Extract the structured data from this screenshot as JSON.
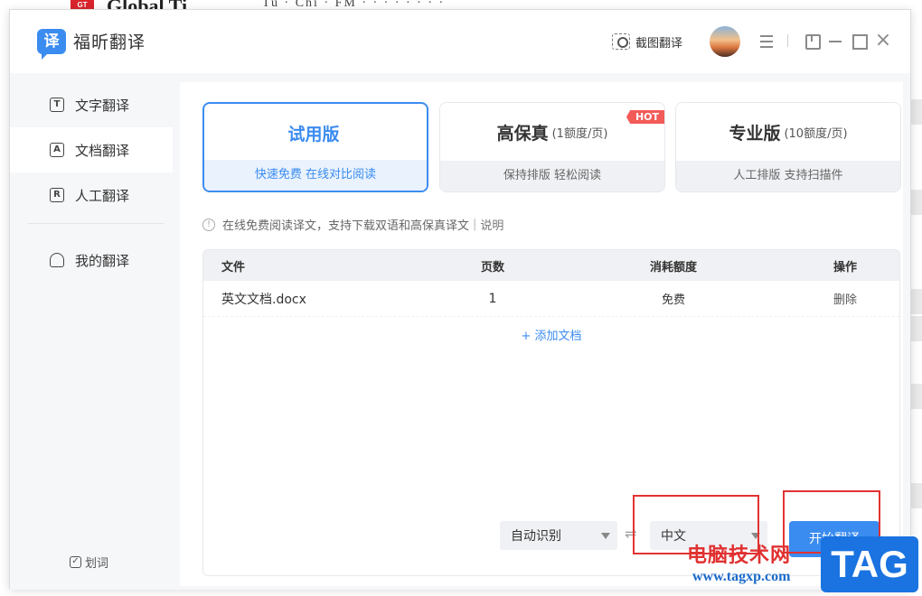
{
  "background": {
    "site_badge": "GT",
    "headline": "Global Ti",
    "subline": "Tu   ·  Chi   ·   FM   ·   ·   ·   ·   ·   ·   ·   ·"
  },
  "titlebar": {
    "logo_char": "译",
    "app_name": "福昕翻译",
    "screenshot_label": "截图翻译",
    "close_glyph": "×"
  },
  "sidebar": {
    "items": [
      {
        "icon": "T",
        "label": "文字翻译"
      },
      {
        "icon": "A",
        "label": "文档翻译"
      },
      {
        "icon": "R",
        "label": "人工翻译"
      },
      {
        "icon": "",
        "label": "我的翻译"
      }
    ],
    "huaci_label": "划词",
    "huaci_check": "✓"
  },
  "plans": [
    {
      "name": "试用版",
      "note": "",
      "desc": "快速免费 在线对比阅读"
    },
    {
      "name": "高保真",
      "note": "(1额度/页)",
      "desc": "保持排版 轻松阅读",
      "badge": "HOT"
    },
    {
      "name": "专业版",
      "note": "(10额度/页)",
      "desc": "人工排版 支持扫描件"
    }
  ],
  "notice": {
    "icon": "!",
    "text": "在线免费阅读译文，支持下载双语和高保真译文",
    "separator": "|",
    "link": "说明"
  },
  "table": {
    "headers": [
      "文件",
      "页数",
      "消耗额度",
      "操作"
    ],
    "rows": [
      {
        "file": "英文文档.docx",
        "pages": "1",
        "cost": "免费",
        "action": "删除"
      }
    ],
    "add_label": "+ 添加文档"
  },
  "controls": {
    "source_lang": "自动识别",
    "swap_glyph": "⇌",
    "target_lang": "中文",
    "start_label": "开始翻译"
  },
  "watermark": {
    "text": "电脑技术网",
    "url": "www.tagxp.com",
    "tag": "TAG"
  },
  "colors": {
    "accent": "#3b8cf0",
    "hot": "#f25b58",
    "highlight_box": "#e23232"
  }
}
